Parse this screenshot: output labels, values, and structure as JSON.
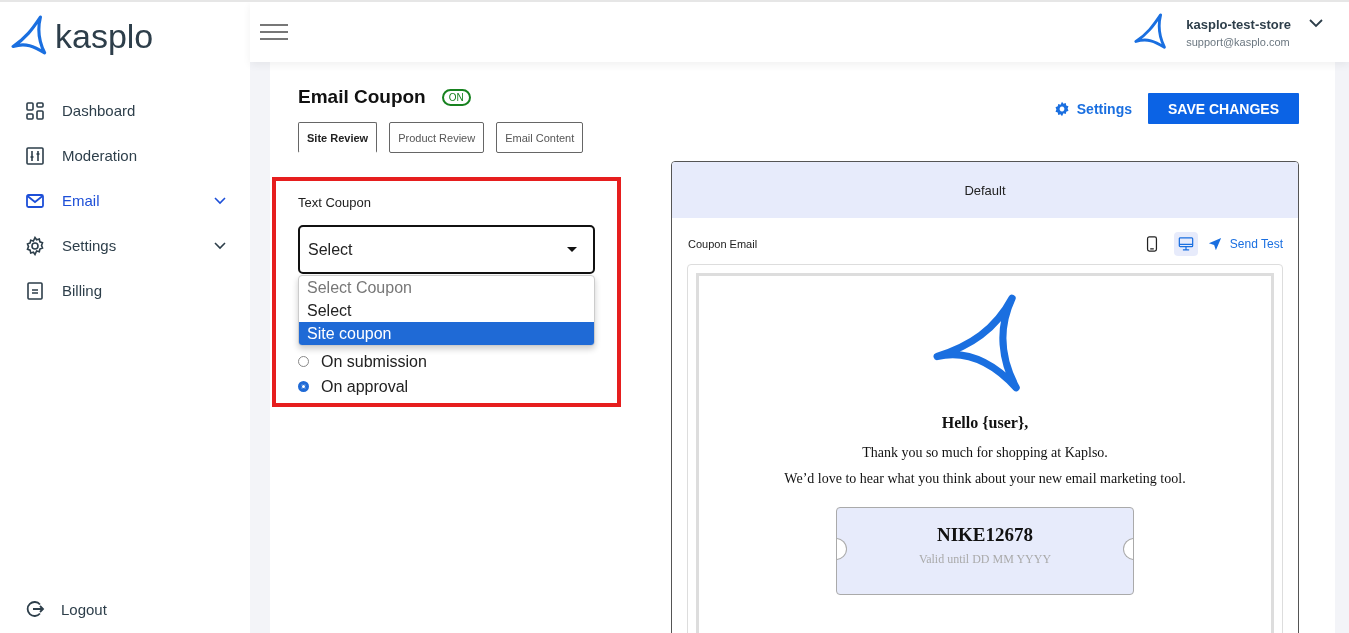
{
  "brand": {
    "name": "kasplo"
  },
  "sidebar": {
    "items": [
      {
        "label": "Dashboard",
        "selected": false,
        "expandable": false
      },
      {
        "label": "Moderation",
        "selected": false,
        "expandable": false
      },
      {
        "label": "Email",
        "selected": true,
        "expandable": true
      },
      {
        "label": "Settings",
        "selected": false,
        "expandable": true
      },
      {
        "label": "Billing",
        "selected": false,
        "expandable": false
      }
    ],
    "logout": "Logout"
  },
  "account": {
    "name": "kasplo-test-store",
    "email": "support@kasplo.com"
  },
  "page": {
    "title": "Email Coupon",
    "status": "ON",
    "settings_link": "Settings",
    "save_button": "SAVE CHANGES"
  },
  "tabs": [
    {
      "label": "Site Review",
      "selected": true
    },
    {
      "label": "Product Review",
      "selected": false
    },
    {
      "label": "Email Content",
      "selected": false
    }
  ],
  "coupon_form": {
    "label": "Text Coupon",
    "highlighted": true,
    "select": {
      "value": "Select",
      "expanded": true,
      "options": [
        {
          "label": "Select Coupon",
          "disabled": true,
          "highlighted": false
        },
        {
          "label": "Select",
          "disabled": false,
          "highlighted": false
        },
        {
          "label": "Site coupon",
          "disabled": false,
          "highlighted": true
        }
      ]
    },
    "radios": [
      {
        "label": "On submission",
        "selected": false
      },
      {
        "label": "On approval",
        "selected": true
      }
    ]
  },
  "preview": {
    "tab": "Default",
    "title": "Coupon Email",
    "devices": [
      {
        "kind": "mobile",
        "selected": false
      },
      {
        "kind": "desktop",
        "selected": true
      }
    ],
    "send_test": "Send Test",
    "email": {
      "greeting": "Hello {user},",
      "lines": [
        "Thank you so much for shopping at Kaplso.",
        "We’d love to hear what you think about your new email marketing tool."
      ],
      "coupon_code": "NIKE12678",
      "validity": "Valid until DD MM YYYY"
    }
  }
}
